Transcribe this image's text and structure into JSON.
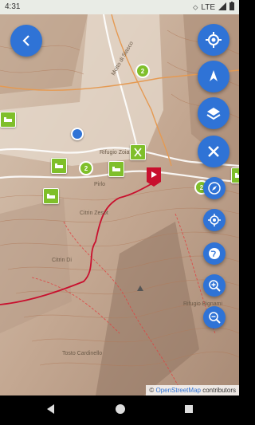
{
  "status_bar": {
    "time": "4:31",
    "network": "LTE"
  },
  "map": {
    "place_labels": [
      "Rifugio Zoia",
      "Pirlo",
      "Motto di Siasco",
      "Citrin Di",
      "Citrin Zesot",
      "Tosto Cardinello",
      "Rifugio Bignami"
    ],
    "clusters": [
      "2",
      "2",
      "2"
    ],
    "poi_types": [
      "hotel-icon",
      "hotel-icon",
      "hotel-icon",
      "hotel-icon",
      "restaurant-icon"
    ],
    "route_color": "#c8102e",
    "trail_color": "#e04040",
    "accent_color": "#2f73d6",
    "poi_color": "#7fbf2a"
  },
  "attribution": {
    "symbol": "©",
    "source": "OpenStreetMap",
    "suffix": "contributors"
  }
}
